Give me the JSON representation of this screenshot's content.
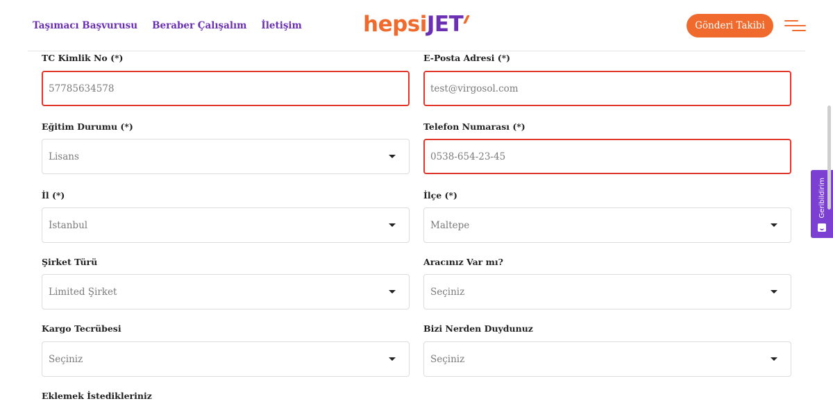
{
  "header": {
    "nav": [
      "Taşımacı Başvurusu",
      "Beraber Çalışalım",
      "İletişim"
    ],
    "logo_part1": "hepsi",
    "logo_part2": "JET",
    "track_button": "Gönderi Takibi"
  },
  "form": {
    "tc_label": "TC Kimlik No (*)",
    "tc_value": "57785634578",
    "email_label": "E-Posta Adresi (*)",
    "email_value": "test@virgosol.com",
    "education_label": "Eğitim Durumu (*)",
    "education_value": "Lisans",
    "phone_label": "Telefon Numarası (*)",
    "phone_value": "0538-654-23-45",
    "city_label": "İl (*)",
    "city_value": "İstanbul",
    "district_label": "İlçe (*)",
    "district_value": "Maltepe",
    "company_label": "Şirket Türü",
    "company_value": "Limited Şirket",
    "vehicle_label": "Aracınız Var mı?",
    "vehicle_value": "Seçiniz",
    "cargo_label": "Kargo Tecrübesi",
    "cargo_value": "Seçiniz",
    "source_label": "Bizi Nerden Duydunuz",
    "source_value": "Seçiniz",
    "notes_label": "Eklemek İstedikleriniz"
  },
  "feedback": {
    "label": "Geribildirim"
  },
  "colors": {
    "brand_orange": "#ef6a2c",
    "brand_purple": "#6b2fb3",
    "error_red": "#e0352b"
  }
}
